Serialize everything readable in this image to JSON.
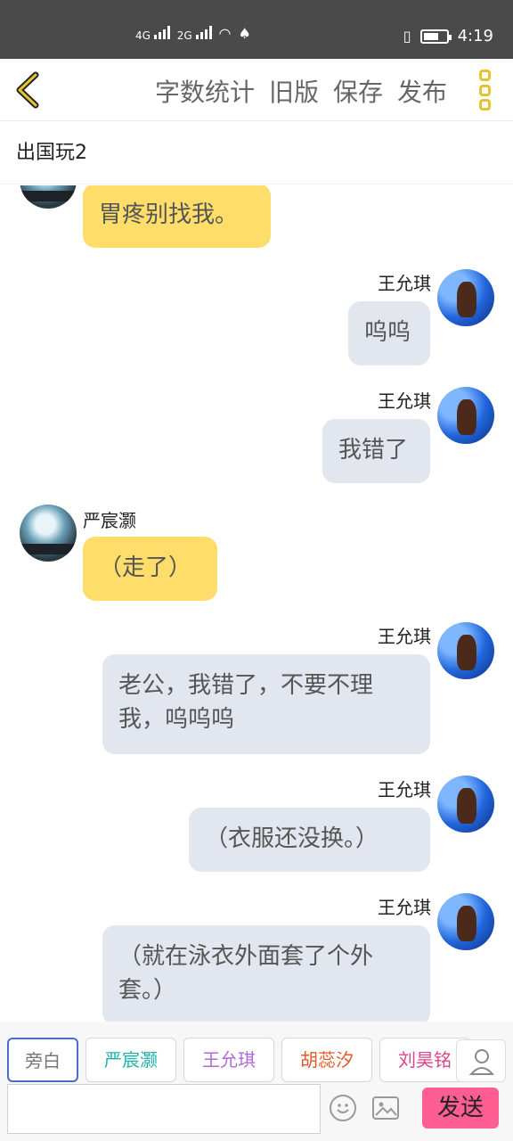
{
  "status": {
    "network1": "4G",
    "network2": "2G",
    "time": "4:19"
  },
  "toolbar": {
    "actions": [
      "字数统计",
      "旧版",
      "保存",
      "发布"
    ]
  },
  "chat": {
    "title": "出国玩2"
  },
  "messages": [
    {
      "side": "left",
      "name": "",
      "text": "胃疼别找我。"
    },
    {
      "side": "right",
      "name": "王允琪",
      "text": "呜呜"
    },
    {
      "side": "right",
      "name": "王允琪",
      "text": "我错了"
    },
    {
      "side": "left",
      "name": "严宸灏",
      "text": "（走了）"
    },
    {
      "side": "right",
      "name": "王允琪",
      "text": "老公，我错了，不要不理我，呜呜呜"
    },
    {
      "side": "right",
      "name": "王允琪",
      "text": "（衣服还没换。）"
    },
    {
      "side": "right",
      "name": "王允琪",
      "text": "（就在泳衣外面套了个外套。）"
    }
  ],
  "characters": [
    {
      "label": "旁白",
      "color": "#777777"
    },
    {
      "label": "严宸灏",
      "color": "#20b2aa"
    },
    {
      "label": "王允琪",
      "color": "#b06ad9"
    },
    {
      "label": "胡蕊汐",
      "color": "#e05a2a"
    },
    {
      "label": "刘昊铭",
      "color": "#e0428a"
    }
  ],
  "composer": {
    "placeholder": "",
    "send_label": "发送"
  }
}
